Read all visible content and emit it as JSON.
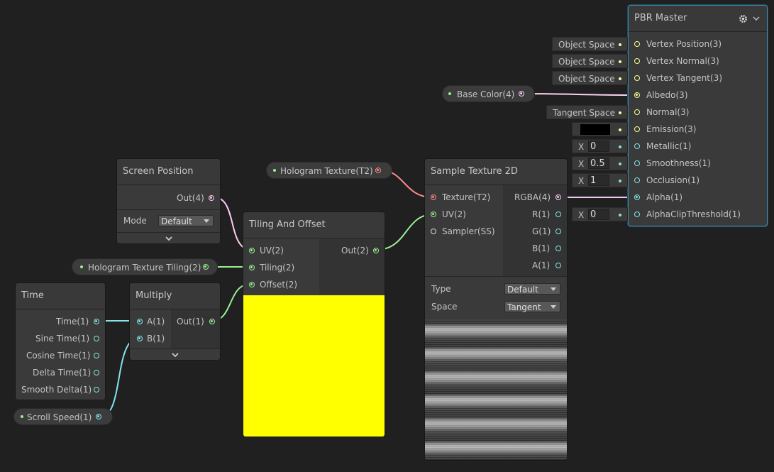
{
  "pbr_master": {
    "title": "PBR Master",
    "icons": [
      "gear-icon",
      "chevron-down-icon"
    ],
    "ports": [
      {
        "label": "Vertex Position(3)",
        "input": "Object Space"
      },
      {
        "label": "Vertex Normal(3)",
        "input": "Object Space"
      },
      {
        "label": "Vertex Tangent(3)",
        "input": "Object Space"
      },
      {
        "label": "Albedo(3)",
        "input": ""
      },
      {
        "label": "Normal(3)",
        "input": "Tangent Space"
      },
      {
        "label": "Emission(3)",
        "input": ""
      },
      {
        "label": "Metallic(1)",
        "input": "0",
        "axis": "X"
      },
      {
        "label": "Smoothness(1)",
        "input": "0.5",
        "axis": "X"
      },
      {
        "label": "Occlusion(1)",
        "input": "1",
        "axis": "X"
      },
      {
        "label": "Alpha(1)",
        "input": ""
      },
      {
        "label": "AlphaClipThreshold(1)",
        "input": "0",
        "axis": "X"
      }
    ]
  },
  "base_color": {
    "label": "Base Color(4)"
  },
  "hologram_texture": {
    "label": "Hologram Texture(T2)"
  },
  "hologram_tiling": {
    "label": "Hologram Texture Tiling(2)"
  },
  "scroll_speed": {
    "label": "Scroll Speed(1)"
  },
  "screen_position": {
    "title": "Screen Position",
    "out": "Out(4)",
    "mode_label": "Mode",
    "mode_value": "Default"
  },
  "tiling_offset": {
    "title": "Tiling And Offset",
    "inputs": [
      "UV(2)",
      "Tiling(2)",
      "Offset(2)"
    ],
    "out": "Out(2)",
    "preview_color": "#ffff00"
  },
  "sample_texture": {
    "title": "Sample Texture 2D",
    "inputs": [
      "Texture(T2)",
      "UV(2)",
      "Sampler(SS)"
    ],
    "outputs": [
      "RGBA(4)",
      "R(1)",
      "G(1)",
      "B(1)",
      "A(1)"
    ],
    "type_label": "Type",
    "type_value": "Default",
    "space_label": "Space",
    "space_value": "Tangent"
  },
  "time_node": {
    "title": "Time",
    "outputs": [
      "Time(1)",
      "Sine Time(1)",
      "Cosine Time(1)",
      "Delta Time(1)",
      "Smooth Delta(1)"
    ]
  },
  "multiply": {
    "title": "Multiply",
    "inputs": [
      "A(1)",
      "B(1)"
    ],
    "out": "Out(1)"
  },
  "colors": {
    "background": "#202020",
    "vector3_port": "#f6ff9a",
    "vector4_port": "#fbcbf4",
    "vector2_port": "#9aef92",
    "vector1_port": "#84e4e7",
    "texture_port": "#ff8b8b",
    "selection_outline": "#44c0ff",
    "emission_color": "#000000"
  }
}
